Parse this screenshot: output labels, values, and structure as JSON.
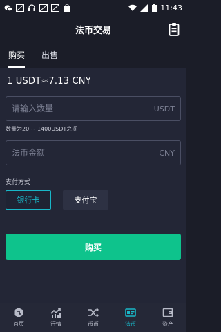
{
  "status_bar": {
    "time": "11:43",
    "left_icons": [
      "wechat-icon",
      "image-icon",
      "headset-icon",
      "image-icon",
      "image-icon",
      "shopping-bag-icon"
    ],
    "right_icons": [
      "wifi-icon",
      "signal-icon",
      "battery-icon"
    ]
  },
  "header": {
    "title": "法币交易",
    "action_icon": "orders-clipboard-icon"
  },
  "tabs": [
    {
      "label": "购买",
      "active": true
    },
    {
      "label": "出售",
      "active": false
    }
  ],
  "form": {
    "rate_text": "1 USDT≈7.13  CNY",
    "quantity": {
      "placeholder": "请输入数量",
      "value": "",
      "unit": "USDT"
    },
    "quantity_hint": "数量为20 ~ 1400USDT之间",
    "amount": {
      "placeholder": "法币金额",
      "value": "",
      "unit": "CNY"
    },
    "payment_label": "支付方式",
    "payment_methods": [
      {
        "label": "银行卡",
        "selected": true
      },
      {
        "label": "支付宝",
        "selected": false
      }
    ],
    "submit_label": "购买"
  },
  "bottom_nav": [
    {
      "label": "首页",
      "icon": "home-icon",
      "active": false
    },
    {
      "label": "行情",
      "icon": "market-chart-icon",
      "active": false
    },
    {
      "label": "币币",
      "icon": "exchange-shuffle-icon",
      "active": false
    },
    {
      "label": "法币",
      "icon": "fiat-card-icon",
      "active": true
    },
    {
      "label": "资产",
      "icon": "wallet-icon",
      "active": false
    }
  ],
  "colors": {
    "background": "#1b1d28",
    "panel": "#232636",
    "accent": "#19b7c8",
    "buy_button": "#0ec38c"
  }
}
